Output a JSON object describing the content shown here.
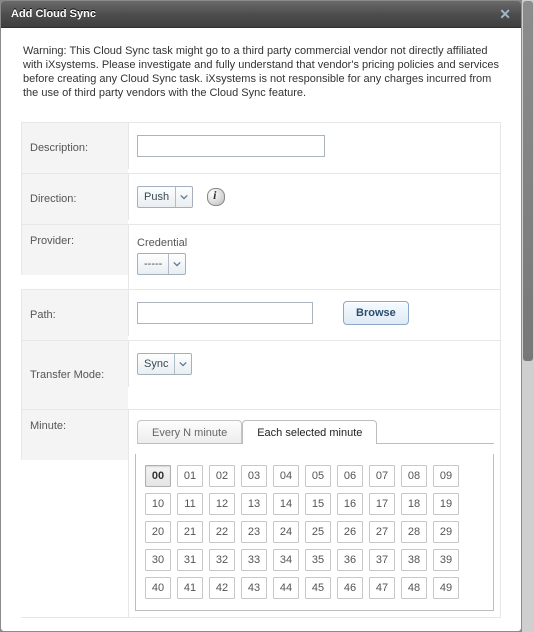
{
  "title": "Add Cloud Sync",
  "warning": "Warning: This Cloud Sync task might go to a third party commercial vendor not directly affiliated with iXsystems. Please investigate and fully understand that vendor's pricing policies and services before creating any Cloud Sync task. iXsystems is not responsible for any charges incurred from the use of third party vendors with the Cloud Sync feature.",
  "labels": {
    "description": "Description:",
    "direction": "Direction:",
    "provider": "Provider:",
    "path": "Path:",
    "transfer_mode": "Transfer Mode:",
    "minute": "Minute:",
    "credential": "Credential"
  },
  "values": {
    "description": "",
    "direction": "Push",
    "credential": "-----",
    "path": "",
    "transfer_mode": "Sync"
  },
  "buttons": {
    "browse": "Browse"
  },
  "tabs": {
    "every": "Every N minute",
    "each": "Each selected minute"
  },
  "minutes": [
    "00",
    "01",
    "02",
    "03",
    "04",
    "05",
    "06",
    "07",
    "08",
    "09",
    "10",
    "11",
    "12",
    "13",
    "14",
    "15",
    "16",
    "17",
    "18",
    "19",
    "20",
    "21",
    "22",
    "23",
    "24",
    "25",
    "26",
    "27",
    "28",
    "29",
    "30",
    "31",
    "32",
    "33",
    "34",
    "35",
    "36",
    "37",
    "38",
    "39",
    "40",
    "41",
    "42",
    "43",
    "44",
    "45",
    "46",
    "47",
    "48",
    "49"
  ],
  "selected_minute": "00"
}
